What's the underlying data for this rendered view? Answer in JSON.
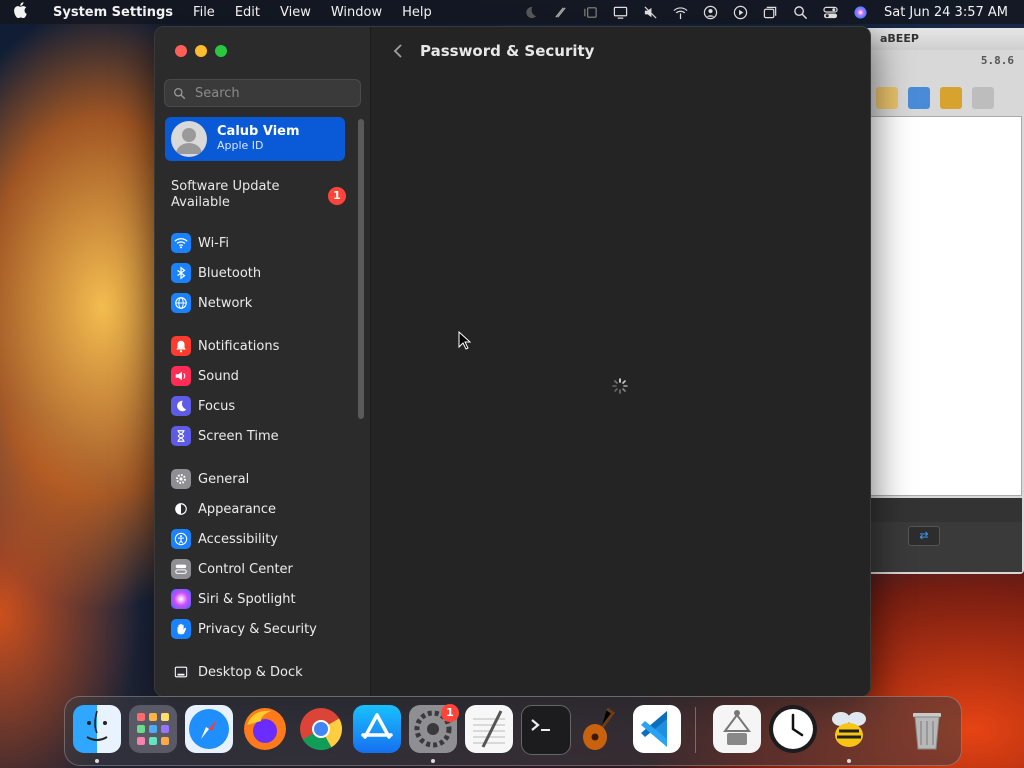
{
  "menubar": {
    "app_name": "System Settings",
    "menus": [
      "File",
      "Edit",
      "View",
      "Window",
      "Help"
    ],
    "status_icons": [
      "moon-icon",
      "pen-icon",
      "stage-manager-icon",
      "display-icon",
      "mute-icon",
      "wifi-off-icon",
      "user-icon",
      "play-icon",
      "windows-icon",
      "search-icon",
      "control-center-icon",
      "siri-icon"
    ],
    "datetime": "Sat Jun 24  3:57 AM"
  },
  "background_window": {
    "title": "aBEEP",
    "version": "5.8.6"
  },
  "settings": {
    "search": {
      "placeholder": "Search",
      "value": ""
    },
    "apple_id": {
      "name": "Calub Viem",
      "subtitle": "Apple ID"
    },
    "software_update": {
      "label": "Software Update Available",
      "badge": "1"
    },
    "sidebar_items": [
      {
        "label": "Wi-Fi",
        "icon": "wifi-icon",
        "color": "#1a82ff"
      },
      {
        "label": "Bluetooth",
        "icon": "bluetooth-icon",
        "color": "#1a82ff"
      },
      {
        "label": "Network",
        "icon": "globe-icon",
        "color": "#1a82ff"
      },
      {
        "label": "Notifications",
        "icon": "bell-icon",
        "color": "#ff3b30"
      },
      {
        "label": "Sound",
        "icon": "speaker-icon",
        "color": "#ff2d55"
      },
      {
        "label": "Focus",
        "icon": "moon-icon",
        "color": "#5e5ce6"
      },
      {
        "label": "Screen Time",
        "icon": "hourglass-icon",
        "color": "#5e5ce6"
      },
      {
        "label": "General",
        "icon": "gear-icon",
        "color": "#8e8e93"
      },
      {
        "label": "Appearance",
        "icon": "appearance-icon",
        "color": "#2c2c2e"
      },
      {
        "label": "Accessibility",
        "icon": "accessibility-icon",
        "color": "#1a82ff"
      },
      {
        "label": "Control Center",
        "icon": "control-center-icon",
        "color": "#8e8e93"
      },
      {
        "label": "Siri & Spotlight",
        "icon": "siri-icon",
        "color": "#8a4fff"
      },
      {
        "label": "Privacy & Security",
        "icon": "hand-icon",
        "color": "#1a82ff"
      },
      {
        "label": "Desktop & Dock",
        "icon": "dock-icon",
        "color": "#2c2c2e"
      }
    ],
    "main": {
      "title": "Password & Security",
      "back_icon": "chevron-left-icon"
    }
  },
  "dock": {
    "apps": [
      "Finder",
      "Launchpad",
      "Safari",
      "Firefox",
      "Chrome",
      "App Store",
      "System Settings",
      "TextEdit",
      "Terminal",
      "GarageBand",
      "Visual Studio Code",
      "",
      "Clock",
      "aBEEP",
      "Trash"
    ],
    "settings_badge": "1"
  }
}
